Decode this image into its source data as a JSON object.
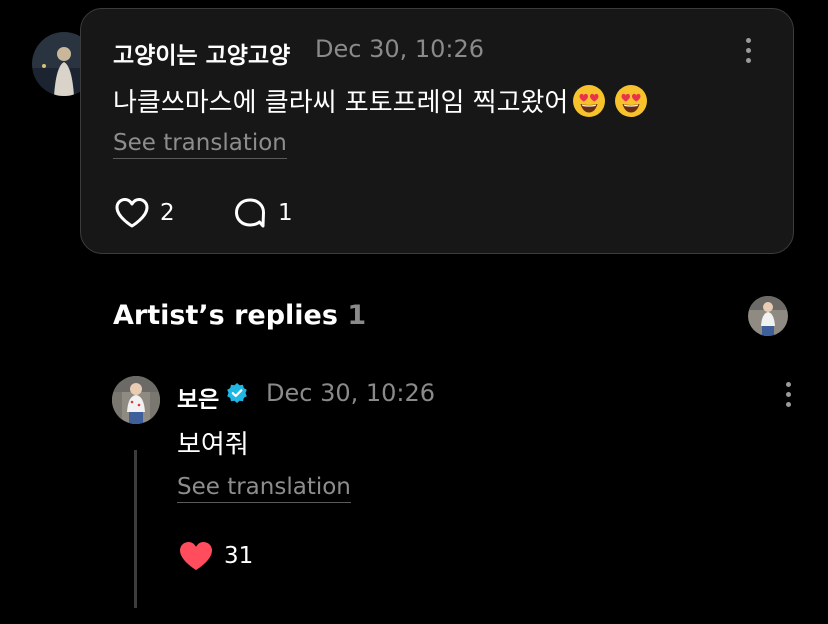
{
  "post": {
    "author": "고양이는 고양고양",
    "time": "Dec 30, 10:26",
    "text": "나클쓰마스에 클라씨 포토프레임 찍고왔어",
    "emojis": [
      "heart-eyes-emoji",
      "heart-eyes-emoji"
    ],
    "see_translation": "See translation",
    "likes": "2",
    "comments": "1"
  },
  "artist_replies": {
    "title": "Artist’s replies",
    "count": "1"
  },
  "reply": {
    "author": "보은",
    "time": "Dec 30, 10:26",
    "text": "보여줘",
    "see_translation": "See translation",
    "likes": "31"
  },
  "colors": {
    "background": "#000000",
    "card": "#171717",
    "verified": "#1fb8e6",
    "liked_heart": "#ff4d5e"
  }
}
